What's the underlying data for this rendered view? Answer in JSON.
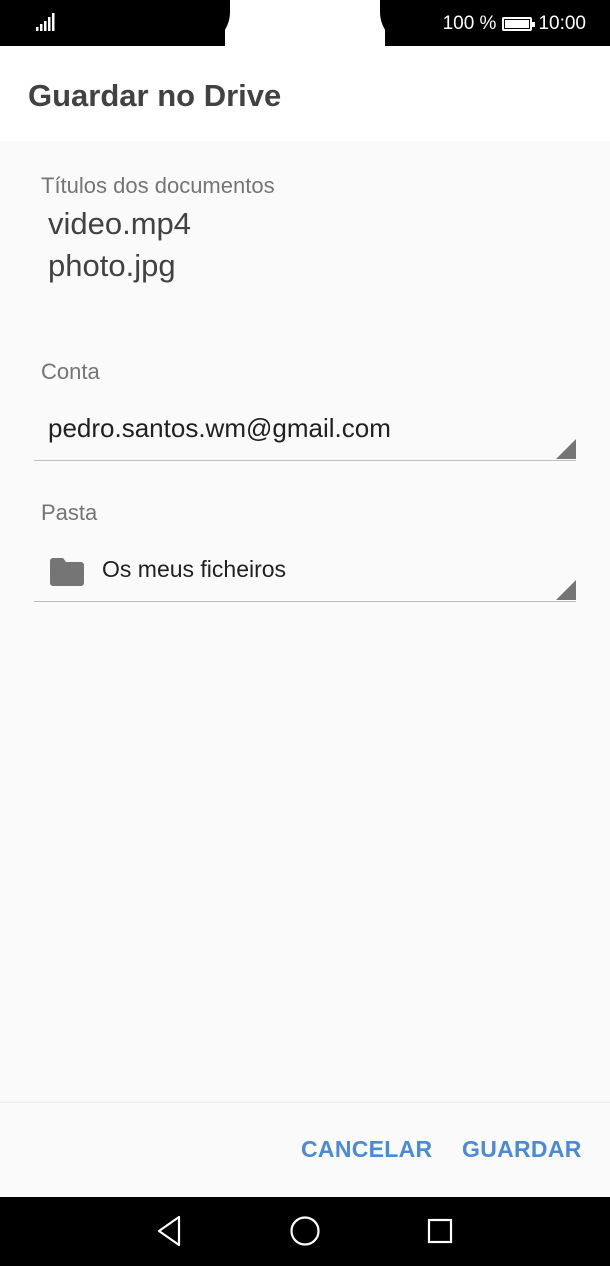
{
  "status_bar": {
    "battery_text": "100 %",
    "time": "10:00"
  },
  "dialog": {
    "title": "Guardar no Drive",
    "documents_label": "Títulos dos documentos",
    "documents": [
      "video.mp4",
      "photo.jpg"
    ],
    "account_label": "Conta",
    "account_value": "pedro.santos.wm@gmail.com",
    "folder_label": "Pasta",
    "folder_value": "Os meus ficheiros",
    "cancel_label": "CANCELAR",
    "save_label": "GUARDAR"
  },
  "colors": {
    "accent": "#4a8ad6",
    "background": "#fafafa"
  },
  "icons": {
    "signal": "signal-icon",
    "battery": "battery-icon",
    "folder": "folder-icon",
    "back": "back-icon",
    "home": "home-icon",
    "recents": "recents-icon"
  }
}
